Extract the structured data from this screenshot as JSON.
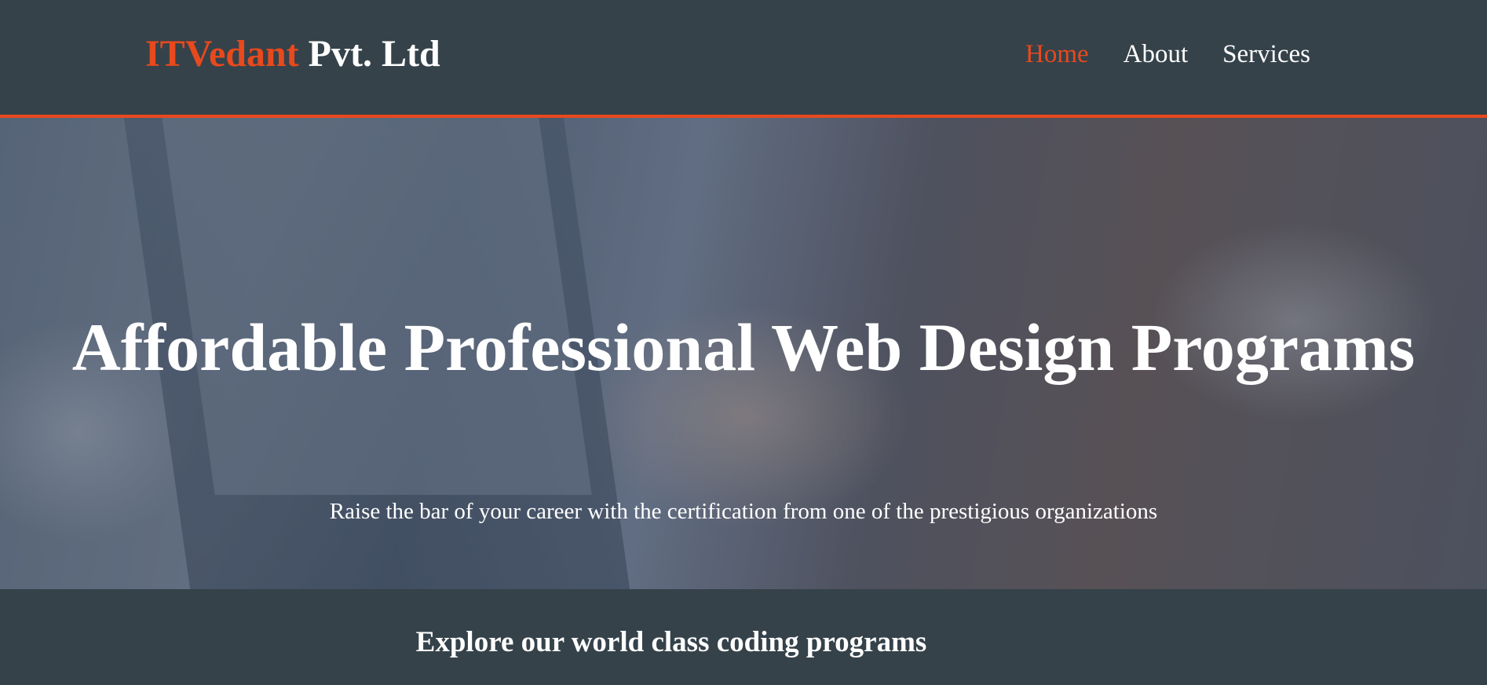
{
  "header": {
    "logo_highlight": "ITVedant",
    "logo_rest": "Pvt. Ltd",
    "nav": [
      {
        "label": "Home",
        "active": true
      },
      {
        "label": "About",
        "active": false
      },
      {
        "label": "Services",
        "active": false
      }
    ]
  },
  "hero": {
    "title": "Affordable Professional Web Design Programs",
    "subtitle": "Raise the bar of your career with the certification from one of the prestigious organizations"
  },
  "explore": {
    "heading": "Explore our world class coding programs"
  },
  "colors": {
    "accent": "#e8491d",
    "dark": "#35424a"
  }
}
